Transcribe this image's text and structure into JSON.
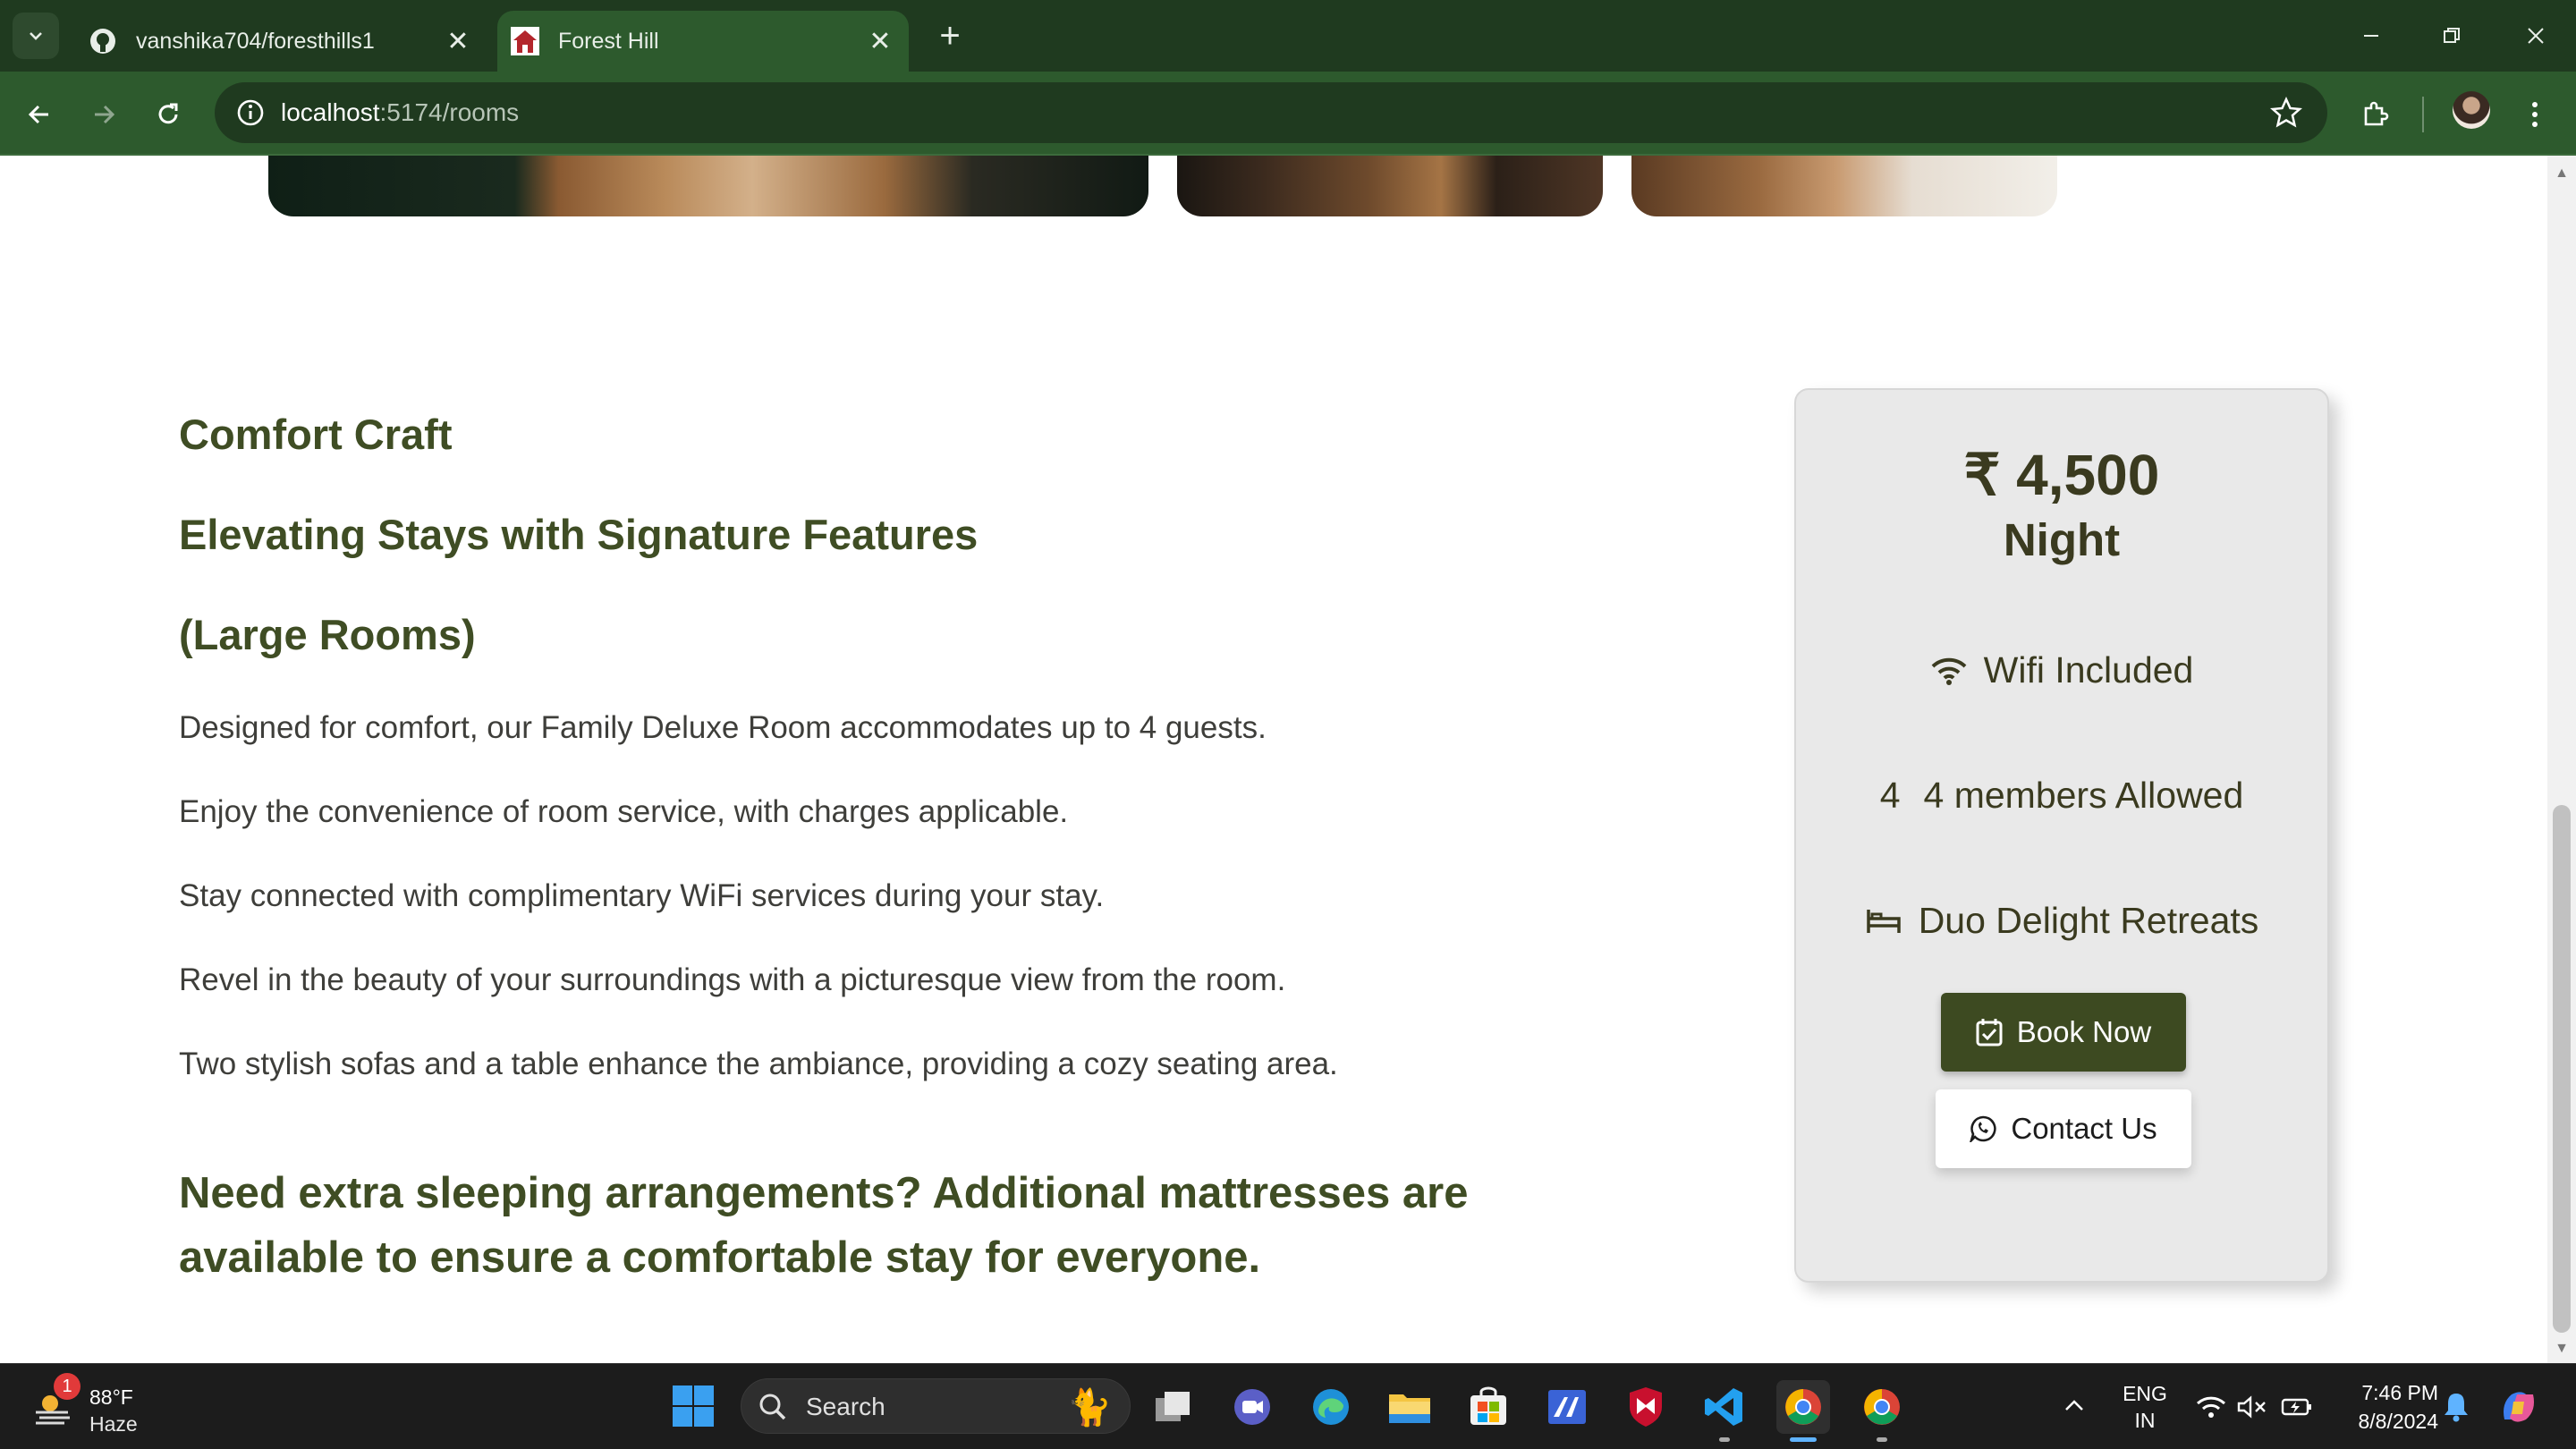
{
  "browser": {
    "tabs": [
      {
        "title": "vanshika704/foresthills1",
        "active": false,
        "icon": "github-icon"
      },
      {
        "title": "Forest Hill",
        "active": true,
        "icon": "house-icon"
      }
    ],
    "url_host": "localhost",
    "url_path": ":5174/rooms"
  },
  "room": {
    "title": "Comfort Craft",
    "subtitle": "Elevating Stays with Signature Features",
    "size_label": "(Large Rooms)",
    "features": [
      "Designed for comfort, our Family Deluxe Room accommodates up to 4 guests.",
      "Enjoy the convenience of room service, with charges applicable.",
      "Stay connected with complimentary WiFi services during your stay.",
      "Revel in the beauty of your surroundings with a picturesque view from the room.",
      "Two stylish sofas and a table enhance the ambiance, providing a cozy seating area."
    ],
    "extra_note": "Need extra sleeping arrangements? Additional mattresses are available to ensure a comfortable stay for everyone."
  },
  "booking_card": {
    "price": "₹ 4,500",
    "per": "Night",
    "wifi": "Wifi Included",
    "members_icon_text": "4",
    "members": "4 members Allowed",
    "beds": "Duo Delight Retreats",
    "book_label": "Book Now",
    "contact_label": "Contact Us"
  },
  "taskbar": {
    "weather_badge": "1",
    "temperature": "88°F",
    "condition": "Haze",
    "search_placeholder": "Search",
    "lang_top": "ENG",
    "lang_bottom": "IN",
    "time": "7:46 PM",
    "date": "8/8/2024"
  },
  "colors": {
    "brand_green": "#3d4a21",
    "heading_olive": "#3f4d24",
    "chrome_dark": "#1f3a1f",
    "chrome_mid": "#2d5a2d"
  }
}
